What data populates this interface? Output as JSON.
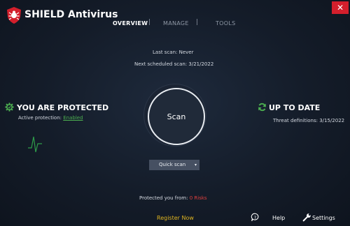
{
  "app": {
    "title": "SHIELD Antivirus"
  },
  "window": {
    "close_glyph": "✕"
  },
  "nav": {
    "overview": "OVERVIEW",
    "manage": "MANAGE",
    "tools": "TOOLS",
    "separator": "|"
  },
  "scan_info": {
    "last_scan_label": "Last scan: Never",
    "next_scan_label": "Next scheduled scan: 3/21/2022"
  },
  "protection": {
    "title": "YOU ARE PROTECTED",
    "active_label": "Active protection:",
    "active_value": "Enabled"
  },
  "updates": {
    "title": "UP TO DATE",
    "definitions_label": "Threat definitions:",
    "definitions_value": "3/15/2022"
  },
  "scan": {
    "button_label": "Scan",
    "mode_label": "Quick scan"
  },
  "threats": {
    "label": "Protected you from:",
    "value": "0 Risks"
  },
  "footer": {
    "register_label": "Register Now",
    "help_label": "Help",
    "settings_label": "Settings"
  },
  "colors": {
    "accent_red": "#d31f2c",
    "ok_green": "#4caf50",
    "risk_red": "#e0403f",
    "register_yellow": "#e0b520"
  },
  "icons": {
    "logo": "shield-bug-logo",
    "protected": "gear-check-icon",
    "uptodate": "refresh-icon",
    "activity": "pulse-graph-icon",
    "help": "chat-help-icon",
    "settings": "wrench-icon"
  }
}
